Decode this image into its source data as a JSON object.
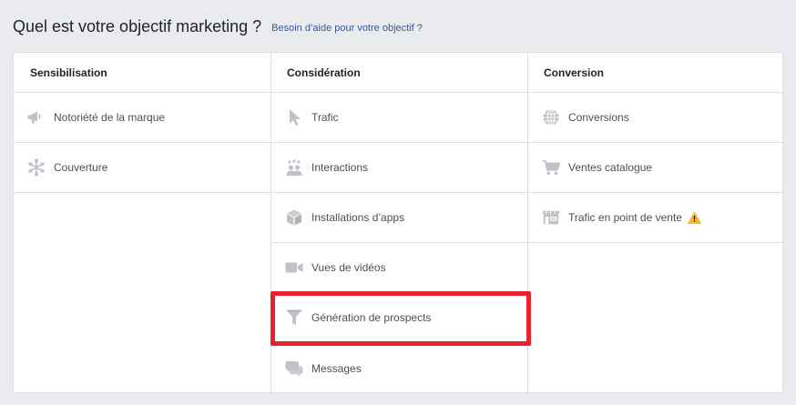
{
  "header": {
    "title": "Quel est votre objectif marketing ?",
    "help_link": "Besoin d’aide pour votre objectif ?"
  },
  "columns": [
    {
      "title": "Sensibilisation",
      "items": [
        {
          "label": "Notoriété de la marque",
          "icon": "megaphone-icon"
        },
        {
          "label": "Couverture",
          "icon": "reach-asterisk-icon"
        }
      ]
    },
    {
      "title": "Considération",
      "items": [
        {
          "label": "Trafic",
          "icon": "cursor-icon"
        },
        {
          "label": "Interactions",
          "icon": "people-icon"
        },
        {
          "label": "Installations d’apps",
          "icon": "box-icon"
        },
        {
          "label": "Vues de vidéos",
          "icon": "video-camera-icon"
        },
        {
          "label": "Génération de prospects",
          "icon": "funnel-icon",
          "highlighted": true
        },
        {
          "label": "Messages",
          "icon": "chat-bubbles-icon"
        }
      ]
    },
    {
      "title": "Conversion",
      "items": [
        {
          "label": "Conversions",
          "icon": "globe-icon"
        },
        {
          "label": "Ventes catalogue",
          "icon": "shopping-cart-icon"
        },
        {
          "label": "Trafic en point de vente",
          "icon": "store-icon",
          "warning": true
        }
      ]
    }
  ],
  "colors": {
    "icon": "#bec2c9",
    "warning": "#f7b928",
    "highlight": "#e8212d",
    "link": "#365899"
  }
}
